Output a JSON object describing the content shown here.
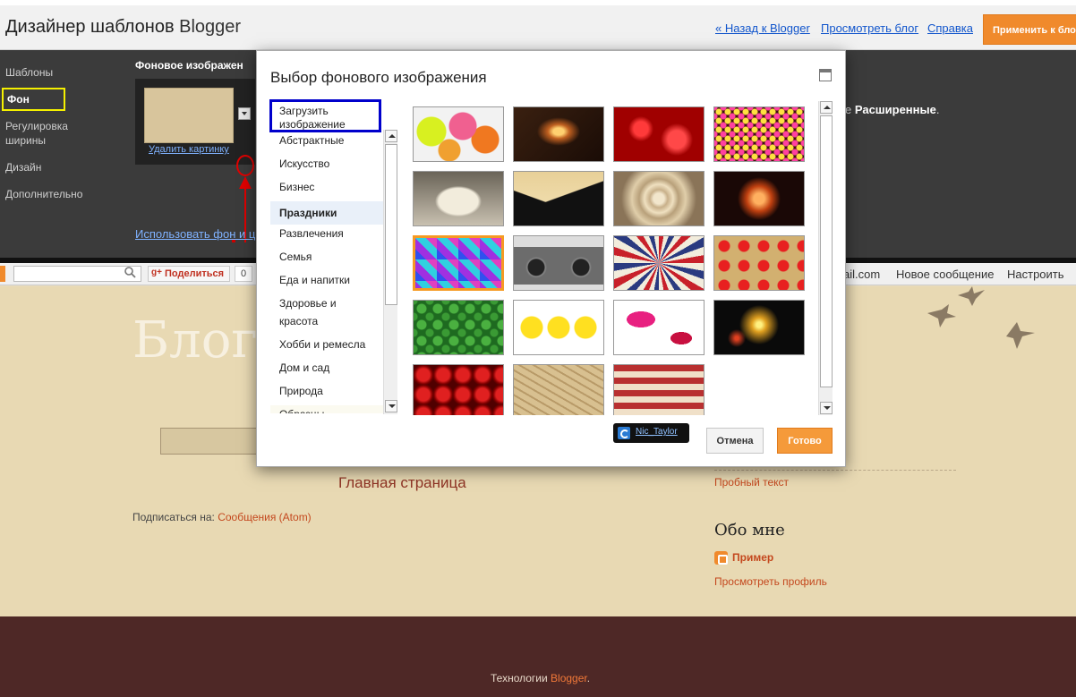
{
  "header": {
    "title_part1": "Дизайнер шаблонов",
    "title_part2": "Blogger",
    "links": {
      "back": "« Назад к Blogger",
      "view": "Просмотреть блог",
      "help": "Справка"
    },
    "apply_button": "Применить к бло"
  },
  "designer": {
    "nav": [
      "Шаблоны",
      "Фон",
      "Регулировка ширины",
      "Дизайн",
      "Дополнительно"
    ],
    "nav_width_line1": "Регулировка",
    "nav_width_line2": "ширины",
    "section_title": "Фоновое изображен",
    "delete_image": "Удалить картинку",
    "use_bg_link": "Использовать фон и цв",
    "advanced_prefix": "е ",
    "advanced_bold": "Расширенные",
    "advanced_suffix": "."
  },
  "blog_navbar": {
    "share": "Поделиться",
    "share_count": "0",
    "mail": "ail.com",
    "new_post": "Новое сообщение",
    "customize": "Настроить"
  },
  "blog": {
    "title": "Блог",
    "home_link": "Главная страница",
    "subscribe_label": "Подписаться на:",
    "subscribe_link": "Сообщения (Atom)",
    "sidebar_test_text": "Пробный текст",
    "about_title": "Обо мне",
    "profile_name": "Пример",
    "view_profile": "Просмотреть профиль",
    "footer_prefix": "Технологии ",
    "footer_link": "Blogger",
    "footer_suffix": "."
  },
  "dialog": {
    "title": "Выбор фонового изображения",
    "upload_line1": "Загрузить",
    "upload_line2": "изображение",
    "categories": [
      "Абстрактные",
      "Искусство",
      "Бизнес",
      "Праздники",
      "Развлечения",
      "Семья",
      "Еда и напитки",
      "Здоровье и",
      "красота",
      "Хобби и ремесла",
      "Дом и сад",
      "Природа",
      "Образцы"
    ],
    "active_category": "Праздники",
    "author": "Nic_Taylor",
    "cancel_button": "Отмена",
    "done_button": "Готово",
    "thumbnails": [
      "lanterns",
      "candles",
      "red-hearts-bokeh",
      "party-lights",
      "wedding-cake",
      "mountain-silhouette",
      "cream-rose",
      "star-lamp",
      "disco-floor",
      "boombox",
      "sunburst-stripes",
      "hearts-pattern",
      "clover-pattern",
      "chicks",
      "lips-pattern",
      "fireworks",
      "red-roses",
      "matzah",
      "american-stripes"
    ],
    "selected_thumbnail": "disco-floor"
  },
  "colors": {
    "accent_orange": "#f08a2c",
    "link_blue": "#1155cc",
    "blog_link": "#c4481e",
    "footer_bg": "#4e2826",
    "designer_bg": "#3b3b3b"
  }
}
